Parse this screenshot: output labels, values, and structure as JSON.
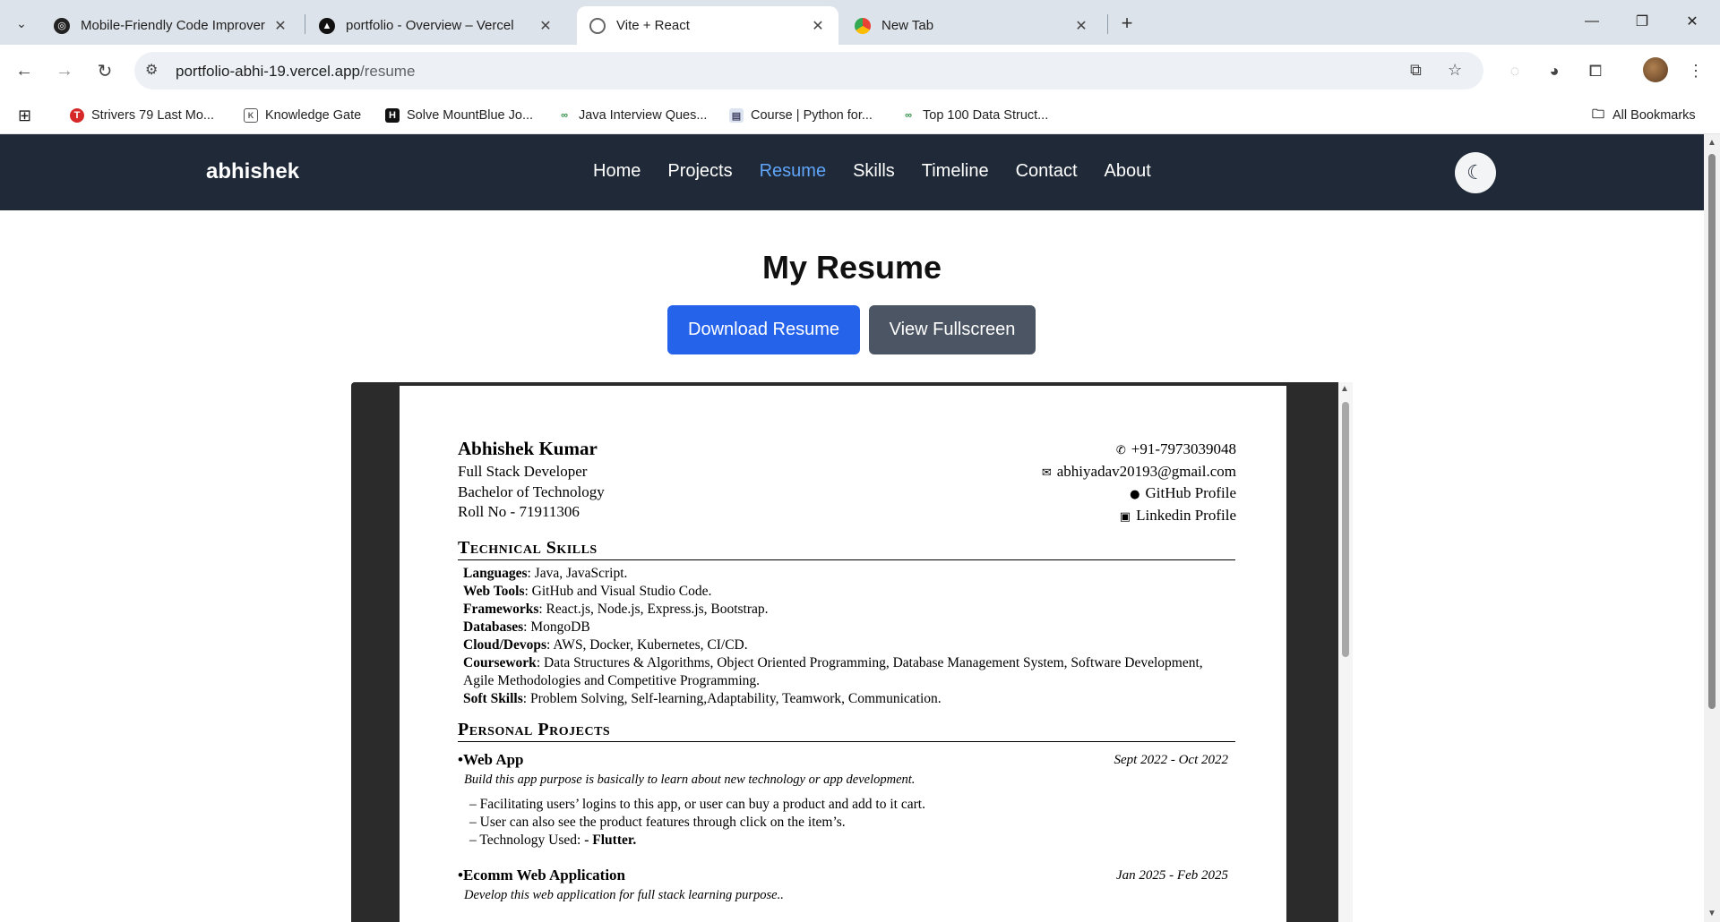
{
  "browser": {
    "tabs": [
      {
        "title": "Mobile-Friendly Code Improver",
        "active": false
      },
      {
        "title": "portfolio - Overview – Vercel",
        "active": false
      },
      {
        "title": "Vite + React",
        "active": true
      },
      {
        "title": "New Tab",
        "active": false
      }
    ],
    "url_host": "portfolio-abhi-19.vercel.app",
    "url_path": "/resume",
    "bookmarks": [
      "Strivers 79 Last Mo...",
      "Knowledge Gate",
      "Solve MountBlue Jo...",
      "Java Interview Ques...",
      "Course | Python for...",
      "Top 100 Data Struct..."
    ],
    "all_bookmarks": "All Bookmarks"
  },
  "site": {
    "brand": "abhishek",
    "nav": [
      "Home",
      "Projects",
      "Resume",
      "Skills",
      "Timeline",
      "Contact",
      "About"
    ],
    "active_nav": "Resume",
    "heading": "My Resume",
    "download_label": "Download Resume",
    "fullscreen_label": "View Fullscreen"
  },
  "resume": {
    "name": "Abhishek Kumar",
    "role": "Full Stack Developer",
    "degree": "Bachelor of Technology",
    "roll": "Roll No - 71911306",
    "phone": "+91-7973039048",
    "email": "abhiyadav20193@gmail.com",
    "github": "GitHub Profile",
    "linkedin": "Linkedin Profile",
    "skills_title": "Technical Skills",
    "skills": [
      {
        "label": "Languages",
        "value": ": Java, JavaScript."
      },
      {
        "label": "Web Tools",
        "value": ": GitHub and Visual Studio Code."
      },
      {
        "label": "Frameworks",
        "value": ": React.js, Node.js, Express.js, Bootstrap."
      },
      {
        "label": "Databases",
        "value": ": MongoDB"
      },
      {
        "label": "Cloud/Devops",
        "value": ": AWS, Docker, Kubernetes, CI/CD."
      },
      {
        "label": "Coursework",
        "value": ": Data Structures & Algorithms, Object Oriented Programming, Database Management System, Software Development, Agile Methodologies and Competitive Programming."
      },
      {
        "label": "Soft Skills",
        "value": ": Problem Solving, Self-learning,Adaptability, Teamwork, Communication."
      }
    ],
    "projects_title": "Personal Projects",
    "projects": [
      {
        "title": "•Web App",
        "date": "Sept 2022 - Oct 2022",
        "desc": "Build this app purpose is basically to learn about new technology or app development.",
        "bullets": [
          "Facilitating users’ logins to this app, or user can buy a product and add to it cart.",
          "User can also see the product features through click on the item’s."
        ],
        "tech_prefix": "Technology Used: ",
        "tech": "- Flutter."
      },
      {
        "title": "•Ecomm Web Application",
        "date": "Jan 2025 - Feb 2025",
        "desc": "Develop this web application for full stack learning purpose.."
      }
    ]
  }
}
